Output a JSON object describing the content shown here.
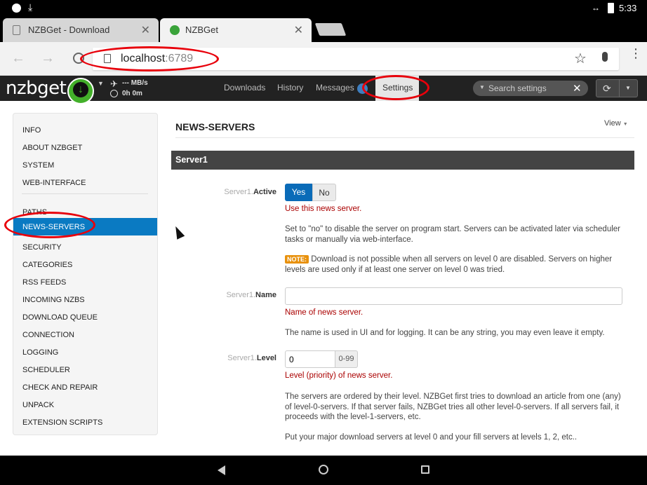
{
  "status_bar": {
    "time": "5:33",
    "battery_icon": "battery-charging-icon",
    "wifi_icon": "wifi-icon"
  },
  "browser": {
    "tabs": [
      {
        "title": "NZBGet - Download"
      },
      {
        "title": "NZBGet"
      }
    ],
    "url_host": "localhost",
    "url_port": ":6789"
  },
  "app": {
    "logo": "nzbget",
    "speed": "--- MB/s",
    "time_left": "0h 0m",
    "nav": [
      "Downloads",
      "History",
      "Messages",
      "Settings"
    ],
    "search_placeholder": "Search settings"
  },
  "sidebar": {
    "group1": [
      "INFO",
      "ABOUT NZBGET",
      "SYSTEM",
      "WEB-INTERFACE"
    ],
    "group2": [
      "PATHS",
      "NEWS-SERVERS",
      "SECURITY",
      "CATEGORIES",
      "RSS FEEDS",
      "INCOMING NZBS",
      "DOWNLOAD QUEUE",
      "CONNECTION",
      "LOGGING",
      "SCHEDULER",
      "CHECK AND REPAIR",
      "UNPACK",
      "EXTENSION SCRIPTS"
    ],
    "active": "NEWS-SERVERS"
  },
  "main": {
    "title": "NEWS-SERVERS",
    "view_label": "View",
    "section": "Server1",
    "active": {
      "prefix": "Server1.",
      "name": "Active",
      "yes": "Yes",
      "no": "No",
      "help": "Use this news server.",
      "desc": "Set to \"no\" to disable the server on program start. Servers can be activated later via scheduler tasks or manually via web-interface.",
      "note_badge": "NOTE:",
      "note": "Download is not possible when all servers on level 0 are disabled. Servers on higher levels are used only if at least one server on level 0 was tried."
    },
    "name": {
      "prefix": "Server1.",
      "name": "Name",
      "value": "",
      "help": "Name of news server.",
      "desc": "The name is used in UI and for logging. It can be any string, you may even leave it empty."
    },
    "level": {
      "prefix": "Server1.",
      "name": "Level",
      "value": "0",
      "range": "0-99",
      "help": "Level (priority) of news server.",
      "desc1": "The servers are ordered by their level. NZBGet first tries to download an article from one (any) of level-0-servers. If that server fails, NZBGet tries all other level-0-servers. If all servers fail, it proceeds with the level-1-servers, etc.",
      "desc2": "Put your major download servers at level 0 and your fill servers at levels 1, 2, etc.."
    }
  }
}
